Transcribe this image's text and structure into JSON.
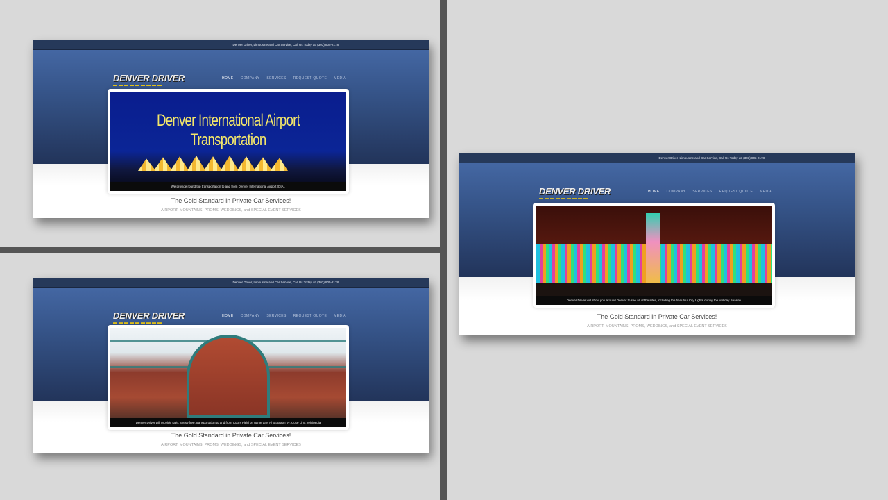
{
  "panels": [
    {
      "topbar": "Denver Driver, Limousine and Car Service, Call Us Today at: (303) 805-2178",
      "logo": "DENVER DRIVER",
      "nav": [
        "HOME",
        "COMPANY",
        "SERVICES",
        "REQUEST QUOTE",
        "MEDIA"
      ],
      "image_title": "Denver International Airport Transportation",
      "caption": "We provide round trip transportation to and from Denver International Airport (DIA).",
      "tagline": "The Gold Standard in Private Car Services!",
      "subline": "AIRPORT, MOUNTAINS, PROMS, WEDDINGS, and SPECIAL EVENT SERVICES"
    },
    {
      "topbar": "Denver Driver, Limousine and Car Service, Call Us Today at: (303) 805-2178",
      "logo": "DENVER DRIVER",
      "nav": [
        "HOME",
        "COMPANY",
        "SERVICES",
        "REQUEST QUOTE",
        "MEDIA"
      ],
      "caption": "Denver Driver will provide safe, stress-free, transportation to and from Coors Field on game day. Photograph by: Coke Lino, Wikipedia",
      "tagline": "The Gold Standard in Private Car Services!",
      "subline": "AIRPORT, MOUNTAINS, PROMS, WEDDINGS, and SPECIAL EVENT SERVICES"
    },
    {
      "topbar": "Denver Driver, Limousine and Car Service, Call Us Today at: (303) 805-2178",
      "logo": "DENVER DRIVER",
      "nav": [
        "HOME",
        "COMPANY",
        "SERVICES",
        "REQUEST QUOTE",
        "MEDIA"
      ],
      "caption": "Denver Driver will show you around Denver to see all of the sites, including the beautiful City Lights during the Holiday Season.",
      "tagline": "The Gold Standard in Private Car Services!",
      "subline": "AIRPORT, MOUNTAINS, PROMS, WEDDINGS, and SPECIAL EVENT SERVICES"
    }
  ]
}
